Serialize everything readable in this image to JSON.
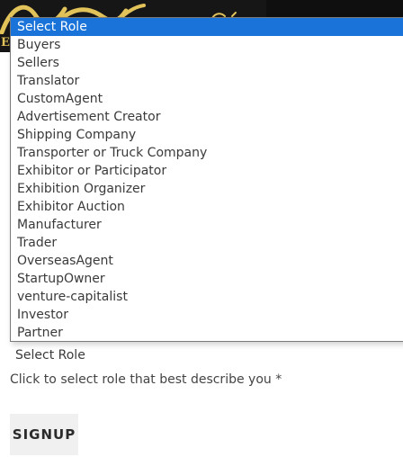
{
  "role_select": {
    "options": [
      "Select Role",
      "Buyers",
      "Sellers",
      "Translator",
      "CustomAgent",
      "Advertisement Creator",
      "Shipping Company",
      "Transporter or Truck Company",
      "Exhibitor or Participator",
      "Exhibition Organizer",
      "Exhibitor Auction",
      "Manufacturer",
      "Trader",
      "OverseasAgent",
      "StartupOwner",
      "venture-capitalist",
      "Investor",
      "Partner"
    ],
    "selected_value": "Select Role",
    "helper_text": "Click to select role that best describe you *"
  },
  "signup_button_label": "SIGNUP",
  "colors": {
    "highlight": "#1a73d9",
    "banner_gold": "#e2c35a",
    "banner_bg": "#161616"
  }
}
